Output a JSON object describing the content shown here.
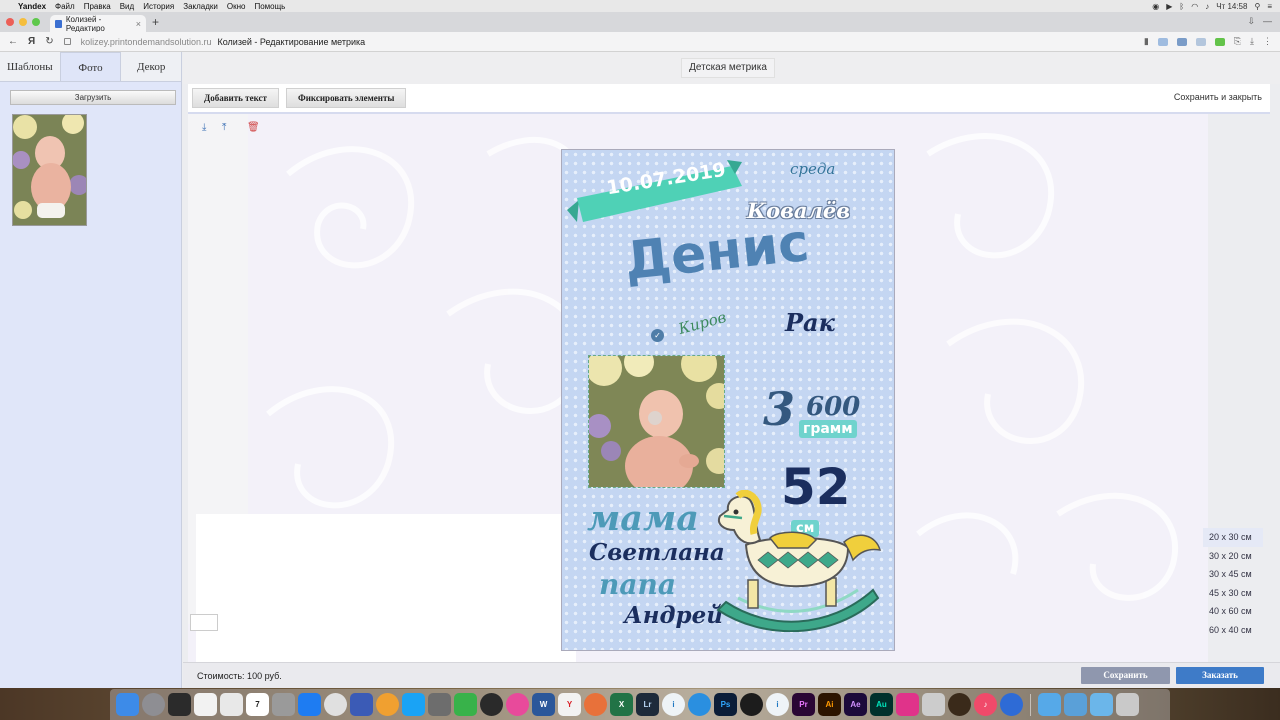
{
  "menubar": {
    "app": "Yandex",
    "items": [
      "Файл",
      "Правка",
      "Вид",
      "История",
      "Закладки",
      "Окно",
      "Помощь"
    ],
    "clock": "Чт 14:58"
  },
  "browser": {
    "tab_title": "Колизей - Редактиро",
    "domain": "kolizey.printondemandsolution.ru",
    "page_title": "Колизей - Редактирование метрика"
  },
  "left_panel": {
    "tabs": [
      "Шаблоны",
      "Фото",
      "Декор"
    ],
    "active_tab": "Фото",
    "upload_label": "Загрузить"
  },
  "editor": {
    "title": "Детская метрика",
    "add_text": "Добавить текст",
    "fix_elements": "Фиксировать элементы",
    "save_close": "Сохранить и закрыть"
  },
  "poster": {
    "date": "10.07.2019",
    "weekday": "среда",
    "surname": "Ковалёв",
    "first_name": "Денис",
    "city": "Киров",
    "zodiac": "Рак",
    "weight_big": "3",
    "weight_small": "600",
    "weight_unit": "грамм",
    "height": "52",
    "height_unit": "см",
    "mama_label": "мама",
    "mama_name": "Светлана",
    "papa_label": "папа",
    "papa_name": "Андрей"
  },
  "sizes": {
    "options": [
      "20 х 30 см",
      "30 х 20 см",
      "30 х 45 см",
      "45 х 30 см",
      "40 х 60 см",
      "60 х 40 см"
    ],
    "selected": "20 х 30 см"
  },
  "footer": {
    "cost": "Стоимость: 100 руб.",
    "save": "Сохранить",
    "order": "Заказать"
  },
  "colors": {
    "poster_bg": "#c4d6f2",
    "ribbon": "#4fd1b6",
    "navy_text": "#1b2e5e",
    "order_button": "#3e7bc8",
    "save_button": "#8f97ae"
  }
}
